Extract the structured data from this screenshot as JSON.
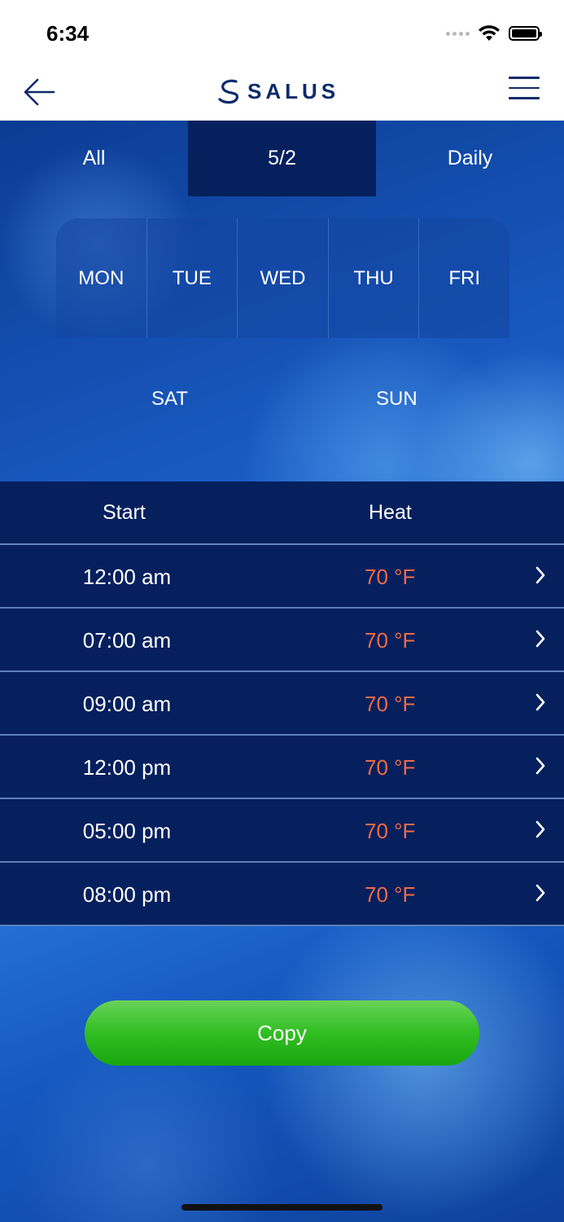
{
  "status_bar": {
    "time": "6:34",
    "icons": [
      "cellular-signal-icon",
      "wifi-icon",
      "battery-icon"
    ]
  },
  "nav": {
    "back_icon": "arrow-left-icon",
    "logo_text": "SALUS",
    "menu_icon": "hamburger-menu-icon"
  },
  "mode_tabs": [
    {
      "label": "All",
      "selected": false
    },
    {
      "label": "5/2",
      "selected": true
    },
    {
      "label": "Daily",
      "selected": false
    }
  ],
  "weekdays": [
    "MON",
    "TUE",
    "WED",
    "THU",
    "FRI"
  ],
  "weekend": [
    "SAT",
    "SUN"
  ],
  "schedule": {
    "headers": {
      "start": "Start",
      "heat": "Heat"
    },
    "rows": [
      {
        "time": "12:00 am",
        "temp": "70 °F"
      },
      {
        "time": "07:00 am",
        "temp": "70 °F"
      },
      {
        "time": "09:00 am",
        "temp": "70 °F"
      },
      {
        "time": "12:00 pm",
        "temp": "70 °F"
      },
      {
        "time": "05:00 pm",
        "temp": "70 °F"
      },
      {
        "time": "08:00 pm",
        "temp": "70 °F"
      }
    ],
    "row_icon": "chevron-right-icon"
  },
  "copy_button": {
    "label": "Copy"
  },
  "colors": {
    "brand_navy": "#0d2a6b",
    "table_bg": "#06205e",
    "temperature": "#f06a45",
    "copy_green": "#31be23"
  }
}
